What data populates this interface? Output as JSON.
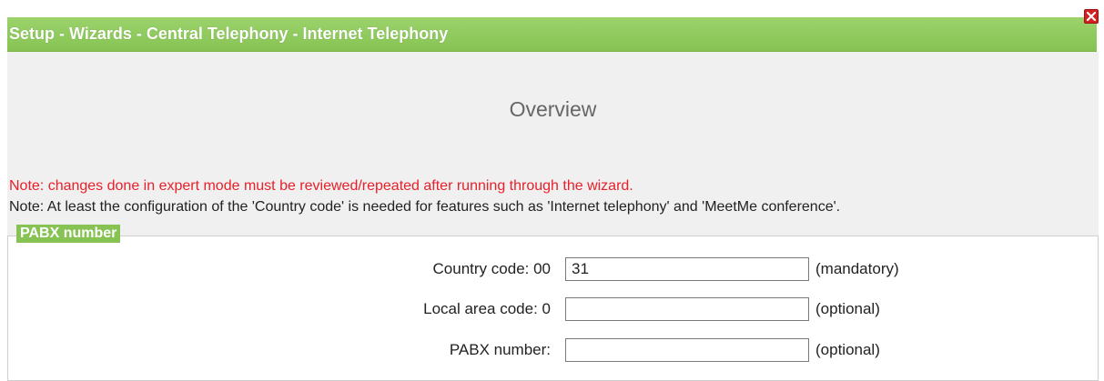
{
  "window": {
    "title": "Setup - Wizards - Central Telephony - Internet Telephony",
    "close_icon": "close-icon"
  },
  "main": {
    "heading": "Overview",
    "note_warning": "Note: changes done in expert mode must be reviewed/repeated after running through the wizard.",
    "note_info": "Note: At least the configuration of the 'Country code' is needed for features such as 'Internet telephony' and 'MeetMe conference'."
  },
  "pabx_section": {
    "legend": "PABX number",
    "fields": [
      {
        "label": "Country code:  00",
        "value": "31",
        "hint": "(mandatory)"
      },
      {
        "label": "Local area code:  0",
        "value": "",
        "hint": "(optional)"
      },
      {
        "label": "PABX number:",
        "value": "",
        "hint": "(optional)"
      }
    ]
  },
  "colors": {
    "title_bar": "#86c353",
    "warning_text": "#e8202a",
    "close_button": "#d42020"
  }
}
